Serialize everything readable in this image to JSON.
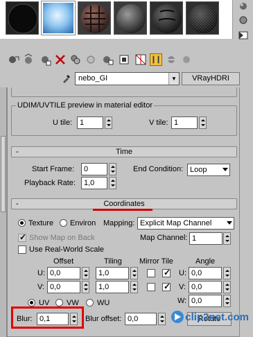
{
  "material_slots": [
    {
      "name": "sky-sphere"
    },
    {
      "name": "checker-sphere"
    },
    {
      "name": "gray-sphere"
    },
    {
      "name": "dark-sphere"
    },
    {
      "name": "noise-sphere"
    }
  ],
  "map_row": {
    "map_name": "nebo_GI",
    "map_type": "VRayHDRI"
  },
  "udim": {
    "title": "UDIM/UVTILE preview in material editor",
    "u_tile_label": "U tile:",
    "u_tile_value": "1",
    "v_tile_label": "V tile:",
    "v_tile_value": "1"
  },
  "time": {
    "title": "Time",
    "minus": "-",
    "start_frame_label": "Start Frame:",
    "start_frame_value": "0",
    "playback_rate_label": "Playback Rate:",
    "playback_rate_value": "1,0",
    "end_condition_label": "End Condition:",
    "end_condition_value": "Loop"
  },
  "coordinates": {
    "title": "Coordinates",
    "minus": "-",
    "texture_label": "Texture",
    "environ_label": "Environ",
    "selected_mode": "Texture",
    "mapping_label": "Mapping:",
    "mapping_value": "Explicit Map Channel",
    "show_map_on_back_label": "Show Map on Back",
    "use_real_world_label": "Use Real-World Scale",
    "map_channel_label": "Map Channel:",
    "map_channel_value": "1",
    "headers": {
      "offset": "Offset",
      "tiling": "Tiling",
      "mirror_tile": "Mirror Tile",
      "angle": "Angle"
    },
    "u_row": {
      "label": "U:",
      "offset": "0,0",
      "tiling": "1,0",
      "mirror": false,
      "tile": true,
      "angle_label": "U:",
      "angle": "0,0"
    },
    "v_row": {
      "label": "V:",
      "offset": "0,0",
      "tiling": "1,0",
      "mirror": false,
      "tile": true,
      "angle_label": "V:",
      "angle": "0,0"
    },
    "w_angle_label": "W:",
    "w_angle": "0,0",
    "uv_label": "UV",
    "vw_label": "VW",
    "wu_label": "WU",
    "selected_axis": "UV",
    "blur_label": "Blur:",
    "blur_value": "0,1",
    "blur_offset_label": "Blur offset:",
    "blur_offset_value": "0,0",
    "rotate_label": "Rotate"
  },
  "watermark": {
    "text": "clip2net.com"
  }
}
